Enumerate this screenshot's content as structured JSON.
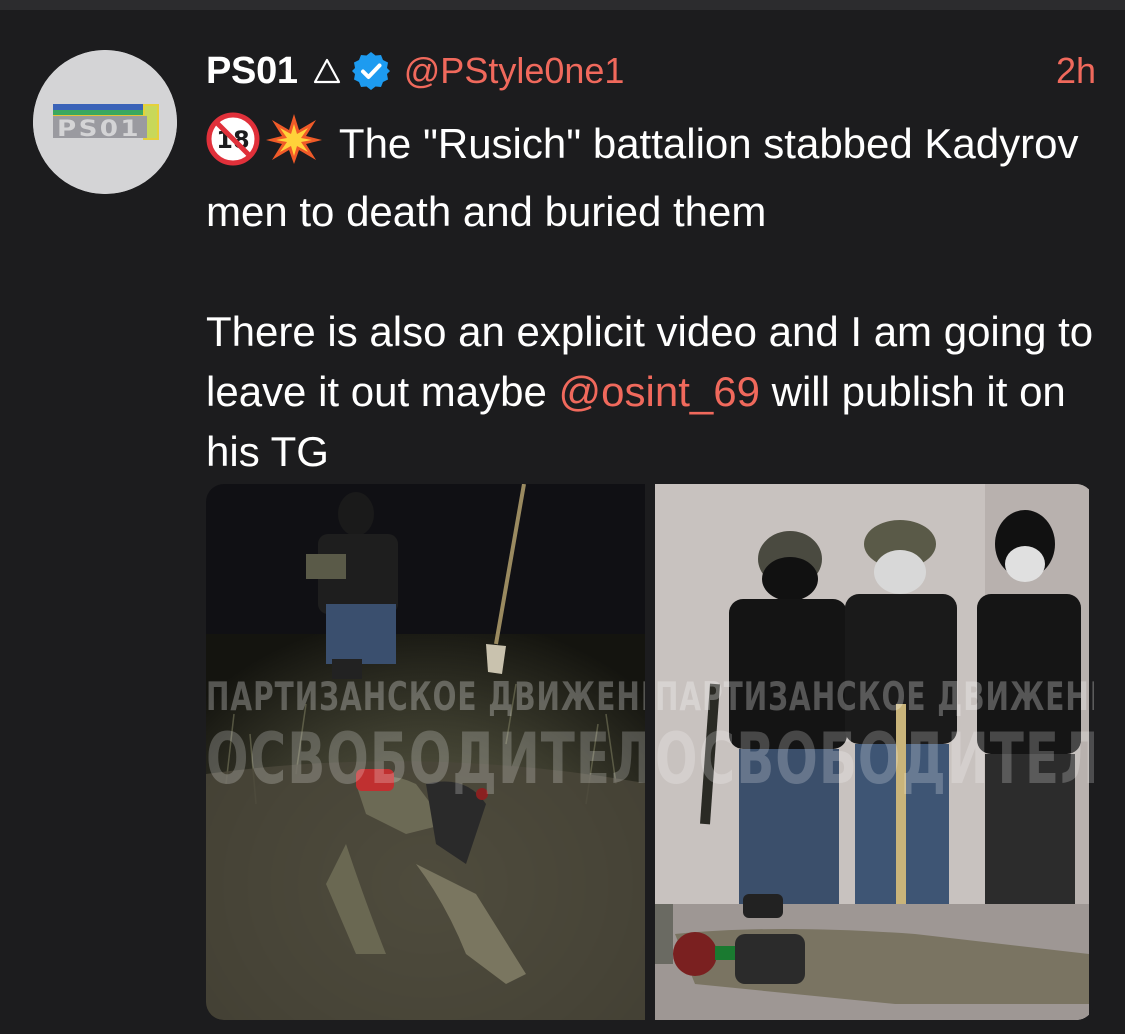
{
  "tweet": {
    "display_name": "PS01",
    "handle": "@PStyle0ne1",
    "timestamp": "2h",
    "verified": true,
    "avatar_text": "PS01",
    "text_line1_emojis": [
      "no-under-18-icon",
      "collision-icon"
    ],
    "text_part1": "The \"Rusich\" battalion stabbed Kadyrov men to death and buried them",
    "text_part2_before": "There is also an explicit video and I am going to leave it out maybe ",
    "text_part2_mention": "@osint_69",
    "text_part2_after": " will publish it on his TG"
  },
  "media": {
    "photo1": {
      "watermark_line1": "ПАРТИЗАНСКОЕ ДВИЖЕНИЕ",
      "watermark_line2": "ОСВОБОДИТЕЛЬ"
    },
    "photo2": {
      "watermark_line1": "ПАРТИЗАНСКОЕ ДВИЖЕНИЕ",
      "watermark_line2": "ОСВОБОДИТЕЛЬ"
    }
  },
  "colors": {
    "background": "#1c1c1e",
    "accent": "#f0695c",
    "verified": "#1d9bf0",
    "text": "#ffffff"
  }
}
